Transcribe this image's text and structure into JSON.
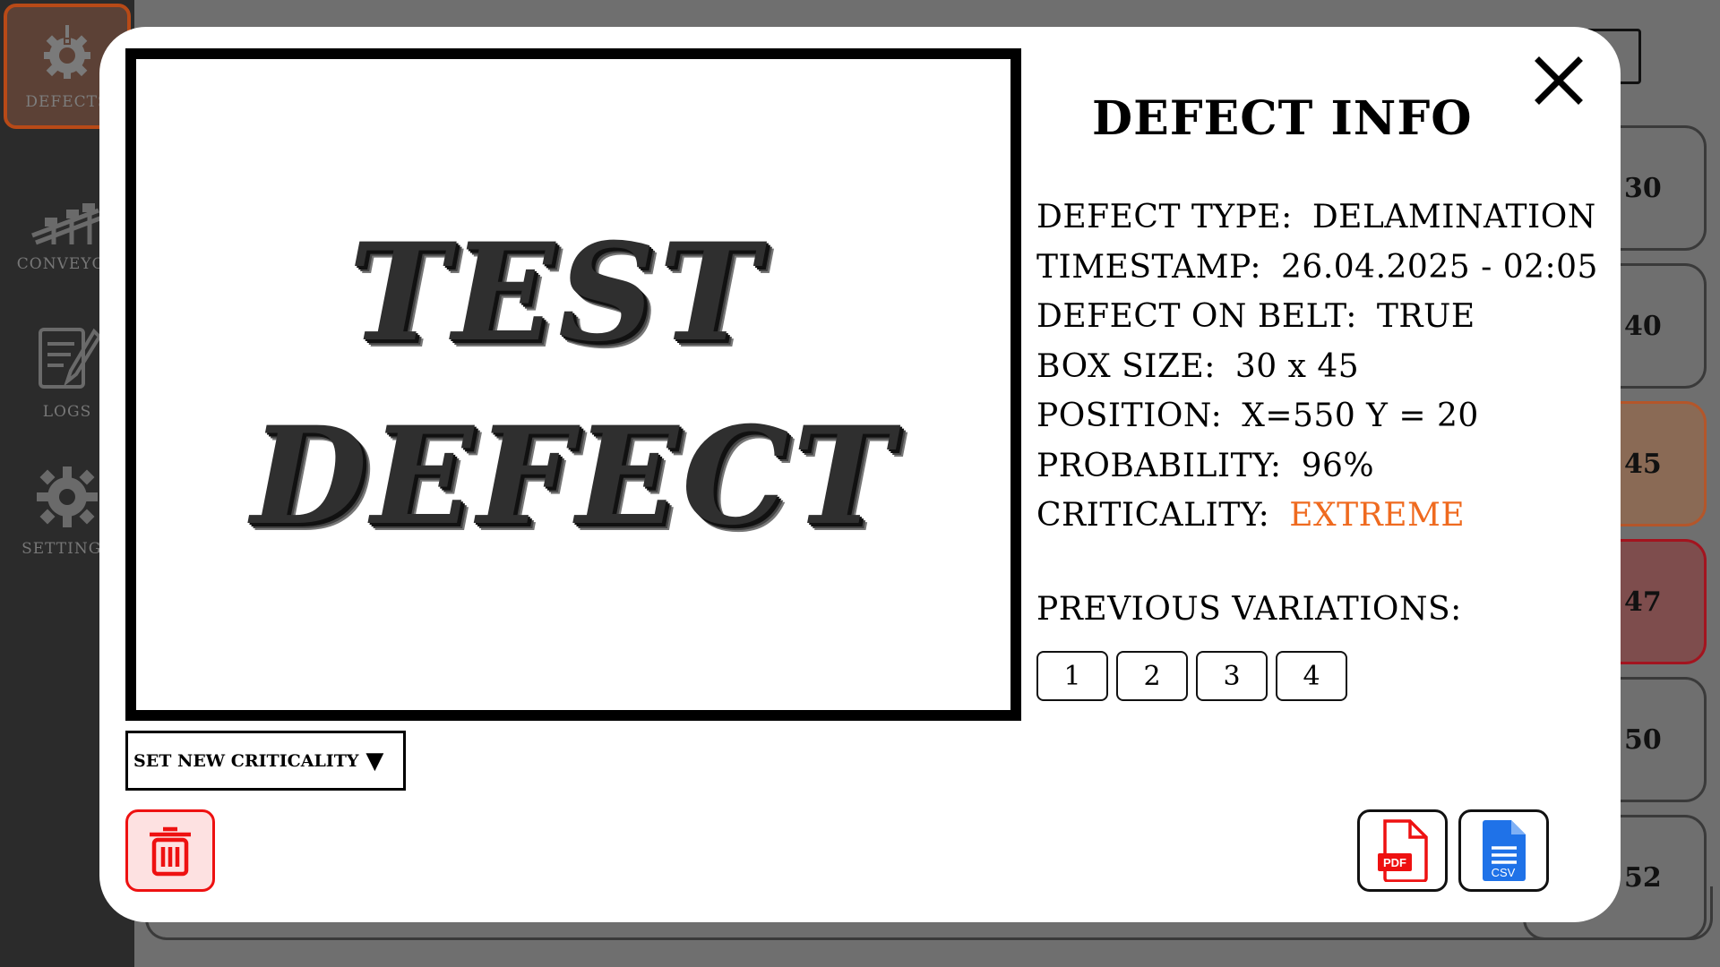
{
  "sidebar": {
    "items": [
      {
        "label": "DEFECTS",
        "icon": "gear-alert-icon",
        "active": true
      },
      {
        "label": "CONVEYOR",
        "icon": "conveyor-icon",
        "active": false
      },
      {
        "label": "LOGS",
        "icon": "logs-icon",
        "active": false
      },
      {
        "label": "SETTINGS",
        "icon": "gear-icon",
        "active": false
      }
    ]
  },
  "background_list": {
    "values": [
      "30",
      "40",
      "45",
      "47",
      "50",
      "52"
    ]
  },
  "image": {
    "line1": "TEST",
    "line2": "DEFECT"
  },
  "info": {
    "title": "DEFECT INFO",
    "defect_type_label": "DEFECT TYPE:",
    "defect_type": "DELAMINATION",
    "timestamp_label": "TIMESTAMP:",
    "timestamp": "26.04.2025 - 02:05",
    "on_belt_label": "DEFECT ON BELT:",
    "on_belt": "TRUE",
    "box_size_label": "BOX SIZE:",
    "box_size": "30 x 45",
    "position_label": "POSITION:",
    "position": "X=550 Y = 20",
    "probability_label": "PROBABILITY:",
    "probability": "96%",
    "criticality_label": "CRITICALITY:",
    "criticality": "EXTREME",
    "criticality_color": "#ef6a1f"
  },
  "variations": {
    "label": "PREVIOUS VARIATIONS:",
    "items": [
      "1",
      "2",
      "3",
      "4"
    ]
  },
  "actions": {
    "set_criticality": "SET NEW CRITICALITY",
    "pdf_label": "PDF",
    "csv_label": "CSV"
  }
}
